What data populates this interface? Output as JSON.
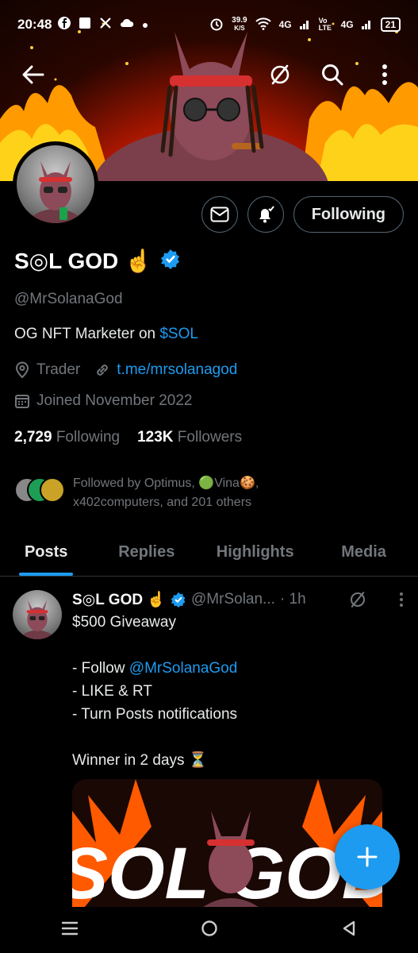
{
  "status_bar": {
    "time": "20:48",
    "net_speed": "39.9",
    "net_unit": "K/S",
    "signal_1": "4G",
    "volte": "Vo LTE",
    "signal_2": "4G",
    "battery": "21"
  },
  "profile": {
    "display_name": "S◎L GOD ☝️",
    "handle": "@MrSolanaGod",
    "bio_prefix": "OG NFT Marketer on ",
    "bio_link": "$SOL",
    "location": "Trader",
    "website": "t.me/mrsolanagod",
    "joined": "Joined November 2022",
    "following_count": "2,729",
    "following_label": "Following",
    "followers_count": "123K",
    "followers_label": "Followers",
    "followed_by": "Followed by Optimus, 🟢Vina🍪, x402computers, and 201 others"
  },
  "actions": {
    "following_button": "Following"
  },
  "tabs": [
    {
      "label": "Posts"
    },
    {
      "label": "Replies"
    },
    {
      "label": "Highlights"
    },
    {
      "label": "Media"
    }
  ],
  "post": {
    "name": "S◎L GOD ☝️",
    "handle": "@MrSolan...",
    "time": "· 1h",
    "lines": [
      "$500 Giveaway",
      "",
      "- Follow ",
      "- LIKE & RT",
      "- Turn Posts notifications",
      "",
      "Winner in 2 days ⏳"
    ],
    "mention": "@MrSolanaGod",
    "media_text": "SOL GOD"
  },
  "colors": {
    "accent": "#1d9bf0",
    "background": "#000000",
    "muted": "#71767b"
  }
}
